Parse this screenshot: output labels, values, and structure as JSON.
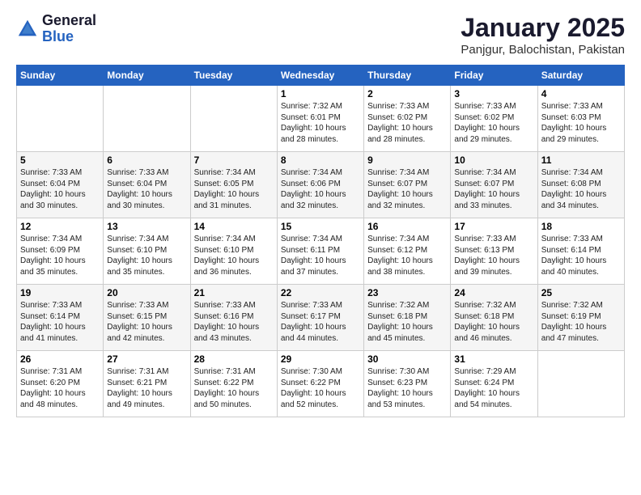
{
  "logo": {
    "general": "General",
    "blue": "Blue"
  },
  "title": "January 2025",
  "subtitle": "Panjgur, Balochistan, Pakistan",
  "weekdays": [
    "Sunday",
    "Monday",
    "Tuesday",
    "Wednesday",
    "Thursday",
    "Friday",
    "Saturday"
  ],
  "weeks": [
    [
      {
        "day": "",
        "info": ""
      },
      {
        "day": "",
        "info": ""
      },
      {
        "day": "",
        "info": ""
      },
      {
        "day": "1",
        "info": "Sunrise: 7:32 AM\nSunset: 6:01 PM\nDaylight: 10 hours\nand 28 minutes."
      },
      {
        "day": "2",
        "info": "Sunrise: 7:33 AM\nSunset: 6:02 PM\nDaylight: 10 hours\nand 28 minutes."
      },
      {
        "day": "3",
        "info": "Sunrise: 7:33 AM\nSunset: 6:02 PM\nDaylight: 10 hours\nand 29 minutes."
      },
      {
        "day": "4",
        "info": "Sunrise: 7:33 AM\nSunset: 6:03 PM\nDaylight: 10 hours\nand 29 minutes."
      }
    ],
    [
      {
        "day": "5",
        "info": "Sunrise: 7:33 AM\nSunset: 6:04 PM\nDaylight: 10 hours\nand 30 minutes."
      },
      {
        "day": "6",
        "info": "Sunrise: 7:33 AM\nSunset: 6:04 PM\nDaylight: 10 hours\nand 30 minutes."
      },
      {
        "day": "7",
        "info": "Sunrise: 7:34 AM\nSunset: 6:05 PM\nDaylight: 10 hours\nand 31 minutes."
      },
      {
        "day": "8",
        "info": "Sunrise: 7:34 AM\nSunset: 6:06 PM\nDaylight: 10 hours\nand 32 minutes."
      },
      {
        "day": "9",
        "info": "Sunrise: 7:34 AM\nSunset: 6:07 PM\nDaylight: 10 hours\nand 32 minutes."
      },
      {
        "day": "10",
        "info": "Sunrise: 7:34 AM\nSunset: 6:07 PM\nDaylight: 10 hours\nand 33 minutes."
      },
      {
        "day": "11",
        "info": "Sunrise: 7:34 AM\nSunset: 6:08 PM\nDaylight: 10 hours\nand 34 minutes."
      }
    ],
    [
      {
        "day": "12",
        "info": "Sunrise: 7:34 AM\nSunset: 6:09 PM\nDaylight: 10 hours\nand 35 minutes."
      },
      {
        "day": "13",
        "info": "Sunrise: 7:34 AM\nSunset: 6:10 PM\nDaylight: 10 hours\nand 35 minutes."
      },
      {
        "day": "14",
        "info": "Sunrise: 7:34 AM\nSunset: 6:10 PM\nDaylight: 10 hours\nand 36 minutes."
      },
      {
        "day": "15",
        "info": "Sunrise: 7:34 AM\nSunset: 6:11 PM\nDaylight: 10 hours\nand 37 minutes."
      },
      {
        "day": "16",
        "info": "Sunrise: 7:34 AM\nSunset: 6:12 PM\nDaylight: 10 hours\nand 38 minutes."
      },
      {
        "day": "17",
        "info": "Sunrise: 7:33 AM\nSunset: 6:13 PM\nDaylight: 10 hours\nand 39 minutes."
      },
      {
        "day": "18",
        "info": "Sunrise: 7:33 AM\nSunset: 6:14 PM\nDaylight: 10 hours\nand 40 minutes."
      }
    ],
    [
      {
        "day": "19",
        "info": "Sunrise: 7:33 AM\nSunset: 6:14 PM\nDaylight: 10 hours\nand 41 minutes."
      },
      {
        "day": "20",
        "info": "Sunrise: 7:33 AM\nSunset: 6:15 PM\nDaylight: 10 hours\nand 42 minutes."
      },
      {
        "day": "21",
        "info": "Sunrise: 7:33 AM\nSunset: 6:16 PM\nDaylight: 10 hours\nand 43 minutes."
      },
      {
        "day": "22",
        "info": "Sunrise: 7:33 AM\nSunset: 6:17 PM\nDaylight: 10 hours\nand 44 minutes."
      },
      {
        "day": "23",
        "info": "Sunrise: 7:32 AM\nSunset: 6:18 PM\nDaylight: 10 hours\nand 45 minutes."
      },
      {
        "day": "24",
        "info": "Sunrise: 7:32 AM\nSunset: 6:18 PM\nDaylight: 10 hours\nand 46 minutes."
      },
      {
        "day": "25",
        "info": "Sunrise: 7:32 AM\nSunset: 6:19 PM\nDaylight: 10 hours\nand 47 minutes."
      }
    ],
    [
      {
        "day": "26",
        "info": "Sunrise: 7:31 AM\nSunset: 6:20 PM\nDaylight: 10 hours\nand 48 minutes."
      },
      {
        "day": "27",
        "info": "Sunrise: 7:31 AM\nSunset: 6:21 PM\nDaylight: 10 hours\nand 49 minutes."
      },
      {
        "day": "28",
        "info": "Sunrise: 7:31 AM\nSunset: 6:22 PM\nDaylight: 10 hours\nand 50 minutes."
      },
      {
        "day": "29",
        "info": "Sunrise: 7:30 AM\nSunset: 6:22 PM\nDaylight: 10 hours\nand 52 minutes."
      },
      {
        "day": "30",
        "info": "Sunrise: 7:30 AM\nSunset: 6:23 PM\nDaylight: 10 hours\nand 53 minutes."
      },
      {
        "day": "31",
        "info": "Sunrise: 7:29 AM\nSunset: 6:24 PM\nDaylight: 10 hours\nand 54 minutes."
      },
      {
        "day": "",
        "info": ""
      }
    ]
  ]
}
